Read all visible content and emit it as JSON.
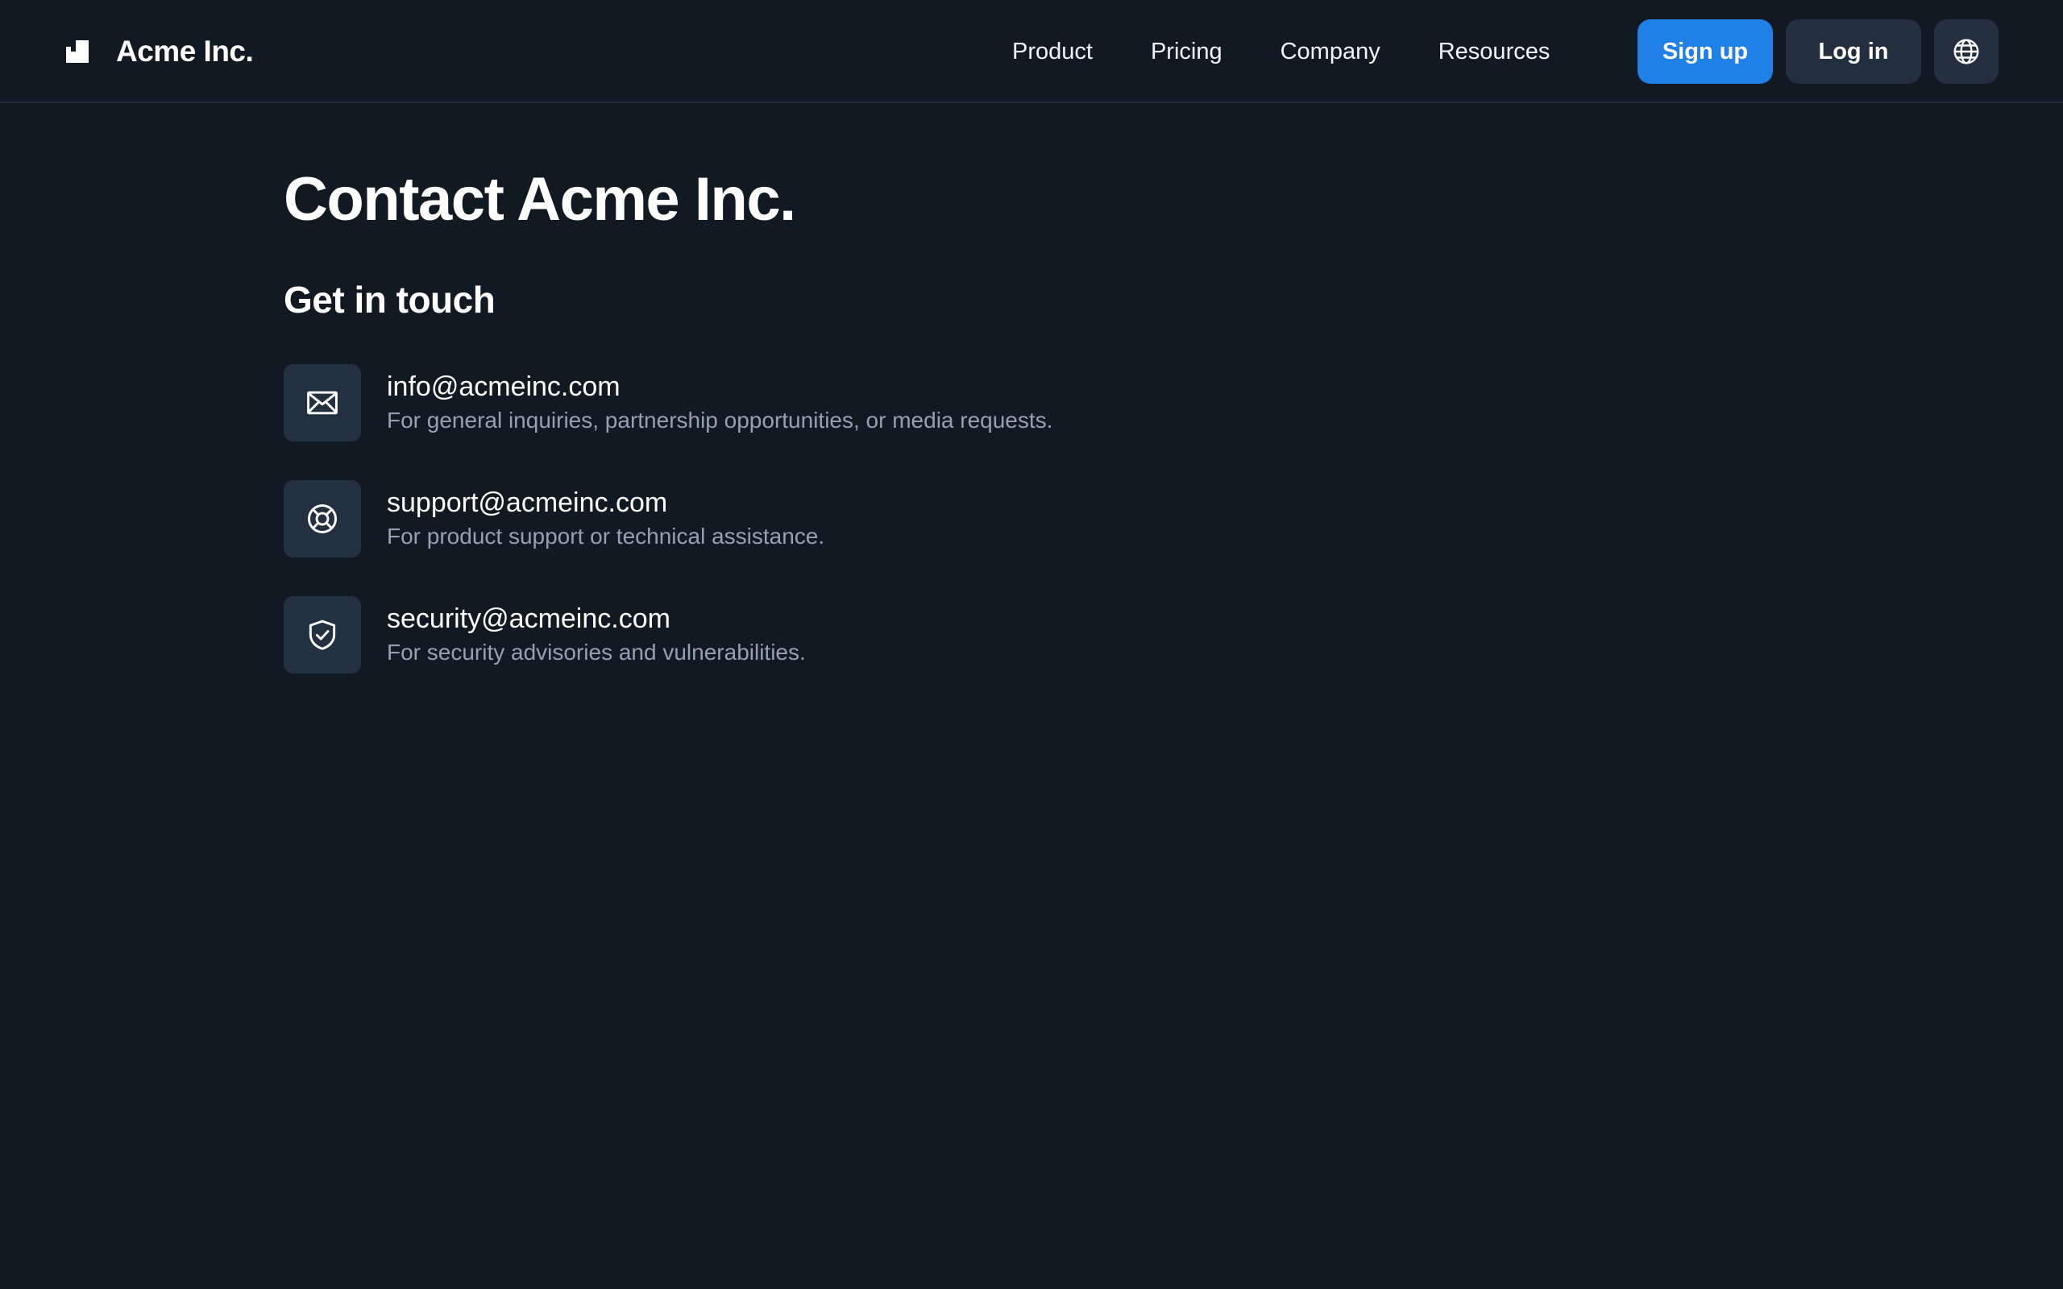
{
  "header": {
    "brand_name": "Acme Inc.",
    "logo_icon": "acme-logo-icon",
    "nav": [
      {
        "label": "Product"
      },
      {
        "label": "Pricing"
      },
      {
        "label": "Company"
      },
      {
        "label": "Resources"
      }
    ],
    "signup_label": "Sign up",
    "login_label": "Log in",
    "language_icon": "globe-icon"
  },
  "main": {
    "title": "Contact Acme Inc.",
    "section_title": "Get in touch",
    "contacts": [
      {
        "icon": "mail-icon",
        "email": "info@acmeinc.com",
        "description": "For general inquiries, partnership opportunities, or media requests."
      },
      {
        "icon": "lifebuoy-icon",
        "email": "support@acmeinc.com",
        "description": "For product support or technical assistance."
      },
      {
        "icon": "shield-check-icon",
        "email": "security@acmeinc.com",
        "description": "For security advisories and vulnerabilities."
      }
    ]
  },
  "colors": {
    "background": "#111a23",
    "accent": "#1f80e6",
    "secondary_button": "#232f3e",
    "icon_tile": "#22303f",
    "muted_text": "#93a1b3",
    "divider": "#232e3b"
  }
}
